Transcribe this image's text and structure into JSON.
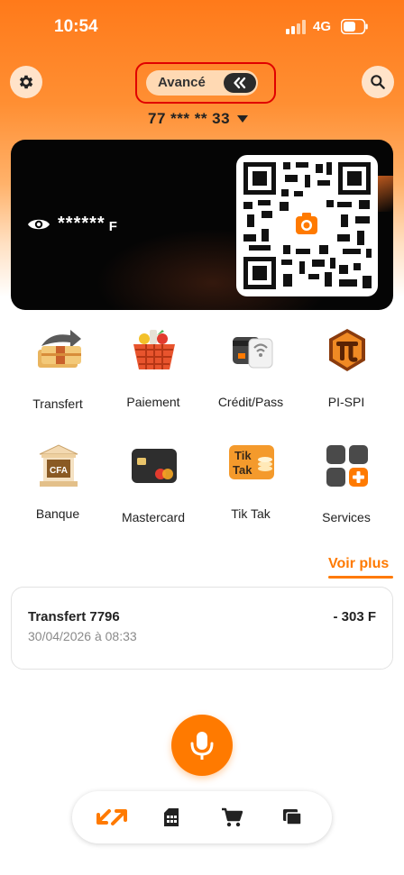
{
  "status_bar": {
    "time": "10:54",
    "network": "4G"
  },
  "header": {
    "mode_label": "Avancé",
    "account_number": "77 *** ** 33"
  },
  "card": {
    "balance_masked": "******",
    "currency": "F"
  },
  "services": [
    {
      "label": "Transfert",
      "icon": "transfer-icon"
    },
    {
      "label": "Paiement",
      "icon": "shopping-basket-icon"
    },
    {
      "label": "Crédit/Pass",
      "icon": "credit-card-contactless-icon"
    },
    {
      "label": "PI-SPI",
      "icon": "pi-icon"
    },
    {
      "label": "Banque",
      "icon": "bank-icon"
    },
    {
      "label": "Mastercard",
      "icon": "mastercard-icon"
    },
    {
      "label": "Tik Tak",
      "icon": "tiktak-icon"
    },
    {
      "label": "Services",
      "icon": "services-grid-icon"
    }
  ],
  "tiktak_logo_text": [
    "Tik",
    "Tak"
  ],
  "bank_logo_text": "CFA",
  "see_more_label": "Voir plus",
  "transactions": [
    {
      "title": "Transfert 7796",
      "date": "30/04/2026 à 08:33",
      "amount": "- 303 F"
    }
  ],
  "colors": {
    "accent": "#ff7a00",
    "card_bg": "#050505",
    "highlight": "#e00000"
  },
  "bottom_nav": [
    "transfers-arrows-icon",
    "sim-card-icon",
    "cart-icon",
    "cards-stack-icon"
  ]
}
